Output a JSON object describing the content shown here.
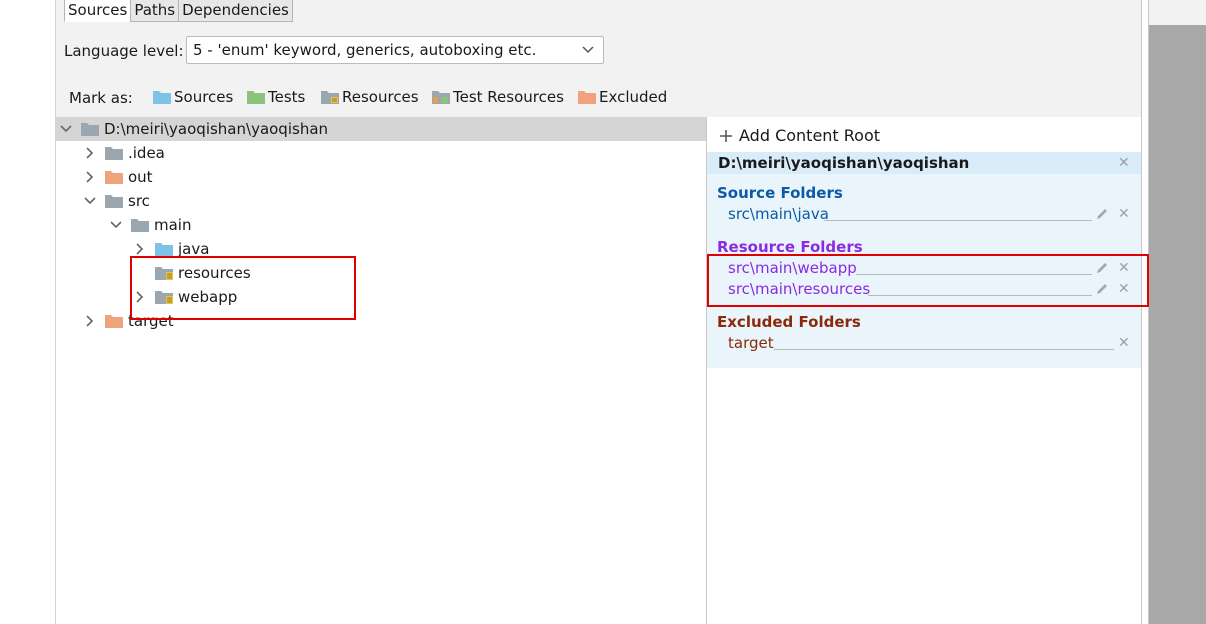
{
  "tabs": [
    {
      "label": "Sources",
      "active": true
    },
    {
      "label": "Paths",
      "active": false
    },
    {
      "label": "Dependencies",
      "active": false
    }
  ],
  "language": {
    "label": "Language level:",
    "value": "5 - 'enum' keyword, generics, autoboxing etc."
  },
  "mark_as": {
    "label": "Mark as:",
    "items": [
      {
        "label": "Sources",
        "icon": "sources-folder-icon",
        "color": "#7ec2e6"
      },
      {
        "label": "Tests",
        "icon": "tests-folder-icon",
        "color": "#8cc37a"
      },
      {
        "label": "Resources",
        "icon": "resources-folder-icon",
        "color": "#9aa7b0"
      },
      {
        "label": "Test Resources",
        "icon": "test-resources-folder-icon",
        "color": "#9aa7b0"
      },
      {
        "label": "Excluded",
        "icon": "excluded-folder-icon",
        "color": "#f0a27a"
      }
    ]
  },
  "tree": {
    "root": "D:\\meiri\\yaoqishan\\yaoqishan",
    "nodes": [
      {
        "label": ".idea",
        "expanded": false,
        "type": "plain"
      },
      {
        "label": "out",
        "expanded": false,
        "type": "excluded"
      },
      {
        "label": "src",
        "expanded": true,
        "type": "plain"
      },
      {
        "label": "main",
        "expanded": true,
        "type": "plain"
      },
      {
        "label": "java",
        "expanded": false,
        "type": "source"
      },
      {
        "label": "resources",
        "expanded": null,
        "type": "resource"
      },
      {
        "label": "webapp",
        "expanded": false,
        "type": "resource"
      },
      {
        "label": "target",
        "expanded": false,
        "type": "excluded"
      }
    ]
  },
  "content_root": {
    "add_label": "Add Content Root",
    "path": "D:\\meiri\\yaoqishan\\yaoqishan",
    "source_title": "Source Folders",
    "source_entries": [
      "src\\main\\java"
    ],
    "resource_title": "Resource Folders",
    "resource_entries": [
      "src\\main\\webapp",
      "src\\main\\resources"
    ],
    "excluded_title": "Excluded Folders",
    "excluded_entries": [
      "target"
    ]
  },
  "colors": {
    "source": "#0a5aa8",
    "resource": "#8a2be2",
    "excluded": "#8b2a0a",
    "highlight": "#e00000"
  }
}
